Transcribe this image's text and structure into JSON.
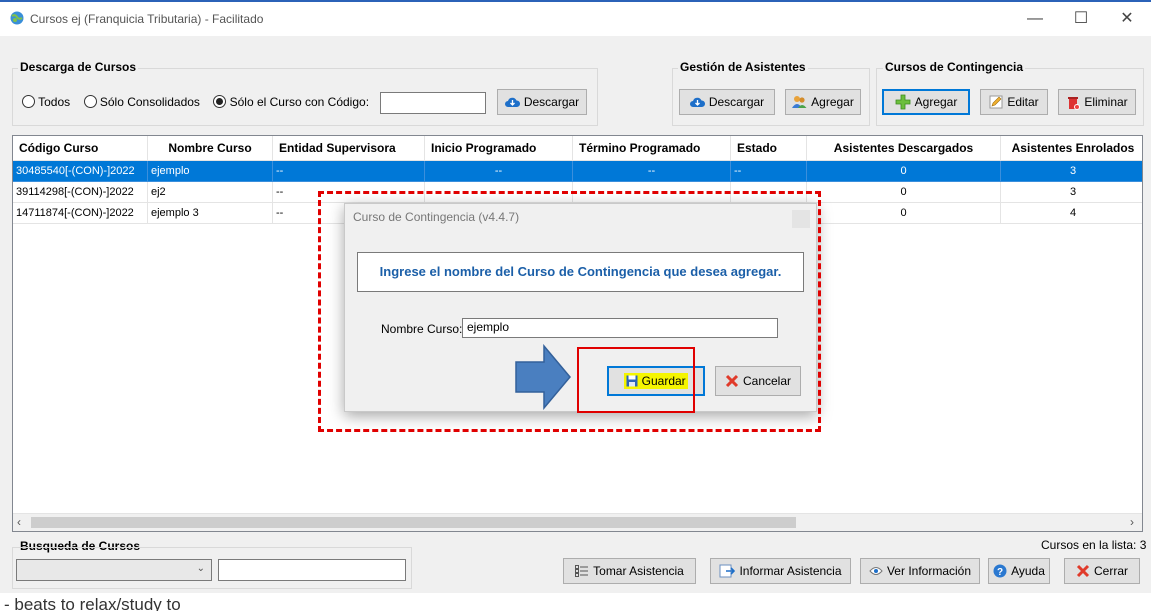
{
  "window": {
    "title": "Cursos ej (Franquicia Tributaria) - Facilitado",
    "controls": {
      "minimize": "—",
      "maximize": "☐",
      "close": "✕"
    }
  },
  "download_group": {
    "title": "Descarga de Cursos",
    "radio_all": "Todos",
    "radio_consolidated": "Sólo Consolidados",
    "radio_code": "Sólo el Curso con Código:",
    "selected": "radio_code",
    "code_value": "",
    "download_button": "Descargar"
  },
  "attendees_group": {
    "title": "Gestión de Asistentes",
    "download_button": "Descargar",
    "add_button": "Agregar"
  },
  "contingency_group": {
    "title": "Cursos de Contingencia",
    "add_button": "Agregar",
    "edit_button": "Editar",
    "delete_button": "Eliminar"
  },
  "table": {
    "headers": [
      "Código Curso",
      "Nombre Curso",
      "Entidad Supervisora",
      "Inicio Programado",
      "Término Programado",
      "Estado",
      "Asistentes Descargados",
      "Asistentes Enrolados"
    ],
    "rows": [
      [
        "30485540[-(CON)-]2022",
        "ejemplo",
        "--",
        "--",
        "--",
        "--",
        "0",
        "3"
      ],
      [
        "39114298[-(CON)-]2022",
        "ej2",
        "--",
        "",
        "",
        "",
        "0",
        "3"
      ],
      [
        "14711874[-(CON)-]2022",
        "ejemplo 3",
        "--",
        "",
        "",
        "",
        "0",
        "4"
      ]
    ],
    "selected_row": 0
  },
  "dialog": {
    "title": "Curso de Contingencia (v4.4.7)",
    "message": "Ingrese el nombre del Curso de Contingencia que desea agregar.",
    "name_label": "Nombre Curso:",
    "name_value": "ejemplo",
    "save_button": "Guardar",
    "cancel_button": "Cancelar"
  },
  "search_group": {
    "title": "Busqueda de Cursos",
    "select_value": "",
    "text_value": ""
  },
  "footer": {
    "count_text": "Cursos en la lista: 3",
    "take_attendance": "Tomar Asistencia",
    "report_attendance": "Informar Asistencia",
    "view_info": "Ver Información",
    "help": "Ayuda",
    "close": "Cerrar"
  },
  "background_text": "- beats to relax/study to",
  "colors": {
    "selection": "#0078d7",
    "annotation_red": "#e00000",
    "highlight": "#f5f500",
    "message_blue": "#1b5fa8"
  }
}
